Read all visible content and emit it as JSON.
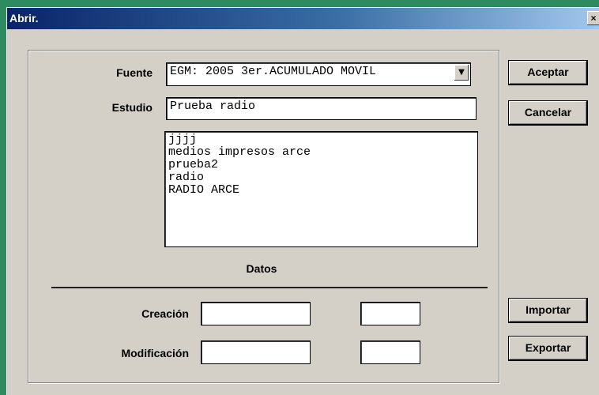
{
  "window": {
    "title": "Abrir.",
    "close_symbol": "×"
  },
  "form": {
    "fuente_label": "Fuente",
    "fuente_value": "EGM: 2005 3er.ACUMULADO MOVIL",
    "estudio_label": "Estudio",
    "estudio_value": "Prueba radio",
    "list_items": [
      "jjjj",
      "medios impresos arce",
      "prueba2",
      "radio",
      "RADIO ARCE"
    ],
    "datos_label": "Datos",
    "creacion_label": "Creación",
    "modificacion_label": "Modificación",
    "creacion_date": "",
    "creacion_time": "",
    "modificacion_date": "",
    "modificacion_time": ""
  },
  "buttons": {
    "aceptar": "Aceptar",
    "cancelar": "Cancelar",
    "importar": "Importar",
    "exportar": "Exportar"
  },
  "icons": {
    "dropdown": "chevron-down-icon",
    "close": "close-icon"
  }
}
